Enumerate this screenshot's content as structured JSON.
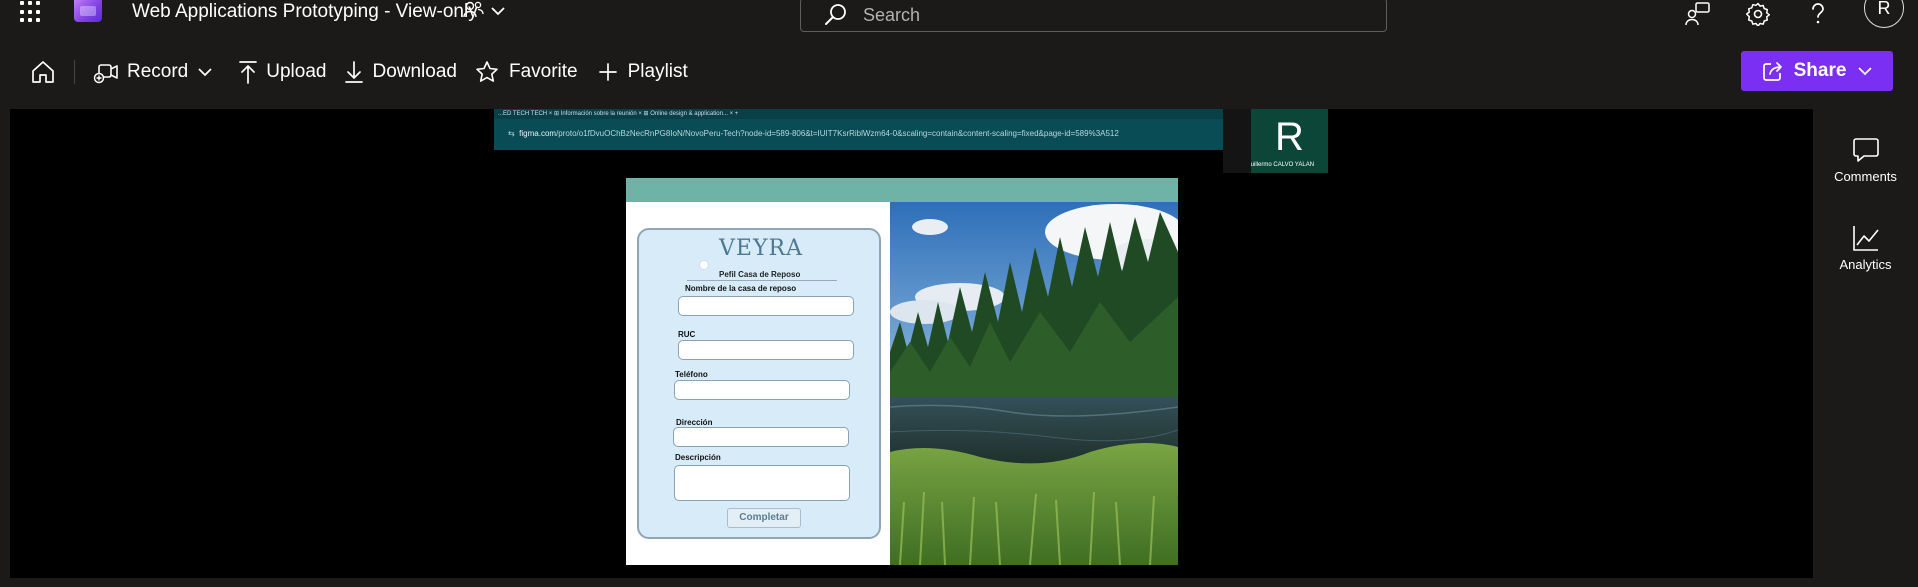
{
  "header": {
    "title": "Web Applications Prototyping - View-only",
    "search_placeholder": "Search",
    "avatar_initial": "R"
  },
  "toolbar": {
    "record_label": "Record",
    "upload_label": "Upload",
    "download_label": "Download",
    "favorite_label": "Favorite",
    "playlist_label": "Playlist",
    "share_label": "Share"
  },
  "right_rail": {
    "comments_label": "Comments",
    "analytics_label": "Analytics"
  },
  "video": {
    "browser_tabs_text": "...ED  TECH  TECH  ×  ⊞  Información sobre la reunión  ×  ⊞  Online design & application...  ×  +",
    "url_domain": "figma.com",
    "url_path": "/proto/o1fDvuOChBzNecRnPG8IoN/NovoPeru-Tech?node-id=589-806&t=IUIT7KsrRiblWzm64-0&scaling=contain&content-scaling=fixed&page-id=589%3A512",
    "participant_initial": "R",
    "participant_name": "Renato Guillermo CALVO YALAN"
  },
  "prototype": {
    "brand": "VEYRA",
    "profile_title": "Pefil Casa de Reposo",
    "fields": [
      {
        "label": "Nombre de la casa de reposo"
      },
      {
        "label": "RUC"
      },
      {
        "label": "Teléfono"
      },
      {
        "label": "Dirección"
      },
      {
        "label": "Descripción"
      }
    ],
    "submit_label": "Completar"
  },
  "colors": {
    "accent": "#7b2ff2",
    "background": "#1b1a19",
    "prototype_band": "#6fb2a6",
    "form_bg": "#d7ecf8"
  }
}
